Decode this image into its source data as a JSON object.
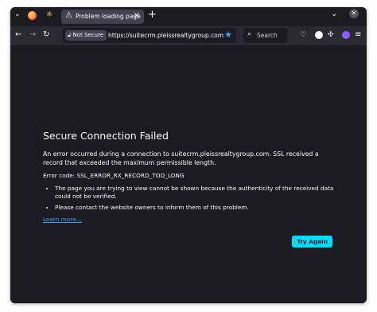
{
  "tabs": [
    {
      "title": "Problem loading page"
    }
  ],
  "navbar": {
    "security_badge": "Not Secure",
    "url": "https://suitecrm.pleissrealtygroup.com",
    "search_placeholder": "Search"
  },
  "error": {
    "title": "Secure Connection Failed",
    "description": "An error occurred during a connection to suitecrm.pleissrealtygroup.com. SSL received a record that exceeded the maximum permissible length.",
    "code": "Error code: SSL_ERROR_RX_RECORD_TOO_LONG",
    "bullets": [
      "The page you are trying to view cannot be shown because the authenticity of the received data could not be verified.",
      "Please contact the website owners to inform them of this problem."
    ],
    "learn_more": "Learn more…",
    "try_again": "Try Again"
  },
  "colors": {
    "background": "#1c1b22",
    "toolbar": "#2b2a33",
    "accent_link": "#3ea4f2",
    "button": "#00ddff"
  }
}
